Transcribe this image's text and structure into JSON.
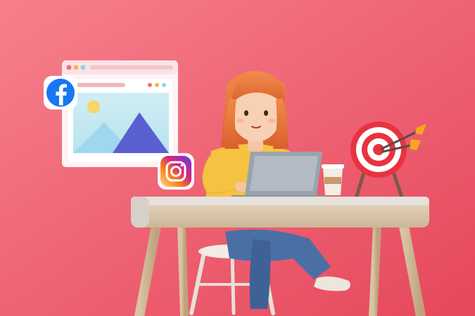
{
  "scene": {
    "background_colors": [
      "#f4707e",
      "#e84a5f"
    ],
    "elements": {
      "browser_window": {
        "icon": "image-placeholder-icon"
      },
      "facebook_logo": {
        "icon": "facebook-icon",
        "color": "#1877f2"
      },
      "instagram_logo": {
        "icon": "instagram-icon",
        "colors": [
          "#feda75",
          "#d62976",
          "#962fbf",
          "#4f5bd5"
        ]
      },
      "target": {
        "icon": "target-with-arrows-icon",
        "color": "#e8333f"
      },
      "laptop": {
        "icon": "laptop-icon"
      },
      "coffee_cup": {
        "icon": "coffee-cup-icon"
      },
      "desk": {
        "icon": "desk-icon"
      },
      "person": {
        "icon": "person-working-icon",
        "hair_color": "#e8713a",
        "shirt_color": "#f5c242",
        "pants_color": "#4a6fa5"
      }
    }
  }
}
